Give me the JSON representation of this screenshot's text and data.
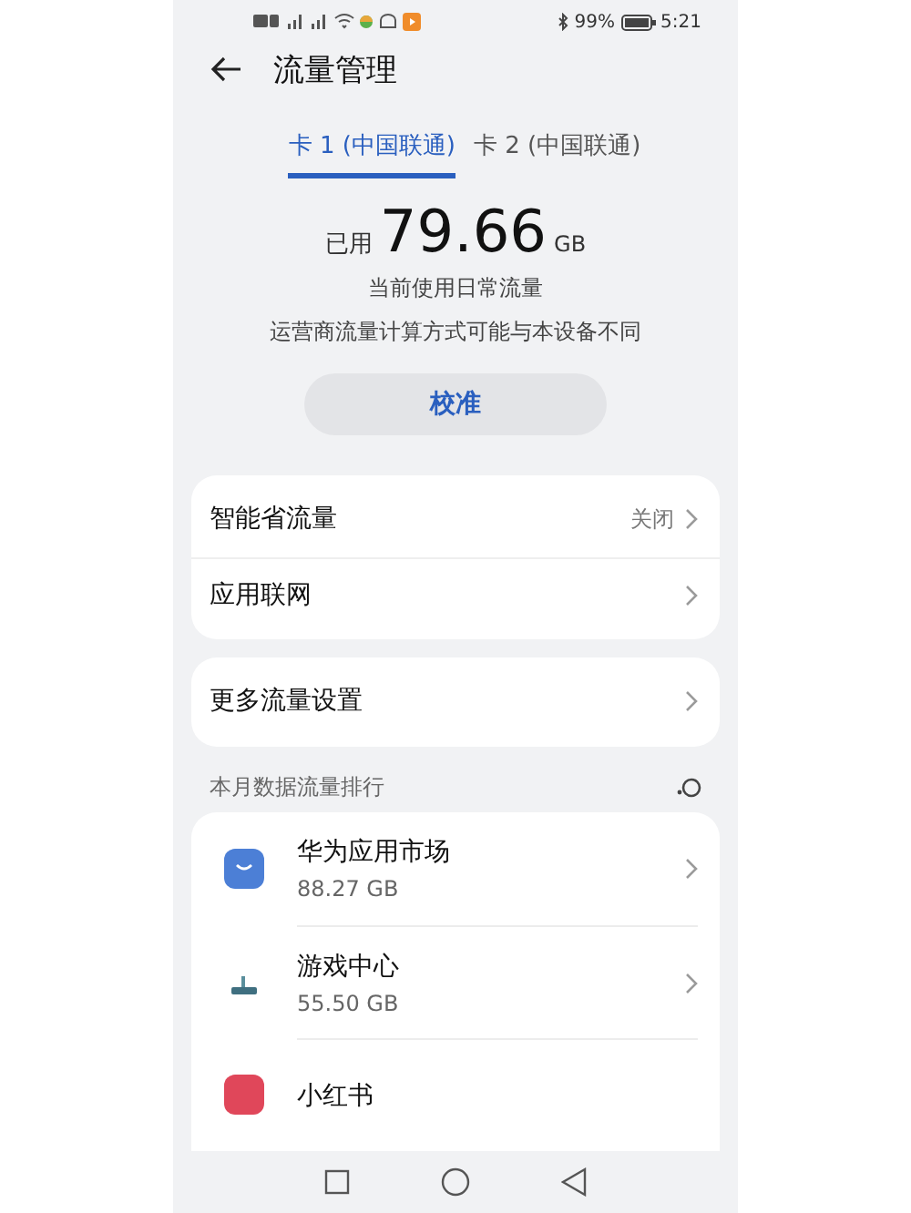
{
  "status_bar": {
    "battery": "99%",
    "time": "5:21"
  },
  "header": {
    "title": "流量管理"
  },
  "tabs": [
    {
      "label": "卡 1 (中国联通)",
      "selected": true
    },
    {
      "label": "卡 2 (中国联通)",
      "selected": false
    }
  ],
  "usage": {
    "prefix": "已用",
    "amount": "79.66",
    "unit": "GB",
    "caption": "当前使用日常流量",
    "note": "运营商流量计算方式可能与本设备不同"
  },
  "calibrate_button": "校准",
  "settings_groups": [
    [
      {
        "label": "智能省流量",
        "value": "关闭"
      },
      {
        "label": "应用联网"
      }
    ],
    [
      {
        "label": "更多流量设置"
      }
    ]
  ],
  "ranking": {
    "title": "本月数据流量排行",
    "apps": [
      {
        "kind": "store",
        "name": "华为应用市场",
        "usage": "88.27 GB"
      },
      {
        "kind": "game",
        "name": "游戏中心",
        "usage": "55.50 GB"
      },
      {
        "kind": "red",
        "name": "小红书"
      }
    ]
  }
}
